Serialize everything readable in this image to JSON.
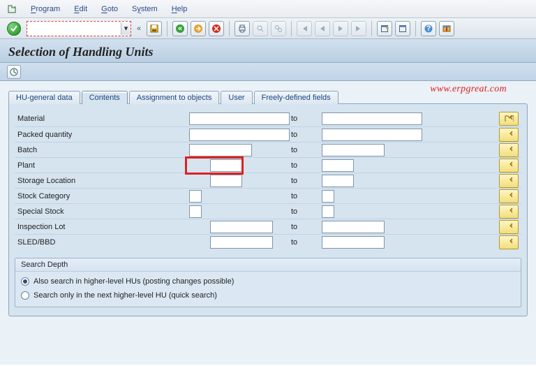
{
  "menu": {
    "items": [
      {
        "pre": "P",
        "rest": "rogram"
      },
      {
        "pre": "E",
        "rest": "dit"
      },
      {
        "pre": "G",
        "rest": "oto"
      },
      {
        "pre": "",
        "rest": "System",
        "nounder": true,
        "upos": 1
      },
      {
        "pre": "H",
        "rest": "elp"
      }
    ]
  },
  "toolbar": {
    "cmd_value": "",
    "back_chevrons": "«"
  },
  "page": {
    "title": "Selection of Handling Units"
  },
  "tabs": [
    {
      "label": "HU-general data",
      "active": false
    },
    {
      "label": "Contents",
      "active": true
    },
    {
      "label": "Assignment to objects",
      "active": false
    },
    {
      "label": "User",
      "active": false
    },
    {
      "label": "Freely-defined fields",
      "active": false
    }
  ],
  "watermark": "www.erpgreat.com",
  "fields": [
    {
      "label": "Material",
      "to": "to",
      "size": "l"
    },
    {
      "label": "Packed quantity",
      "to": "to",
      "size": "l"
    },
    {
      "label": "Batch",
      "to": "to",
      "size": "m"
    },
    {
      "label": "Plant",
      "to": "to",
      "size": "s",
      "highlight": true
    },
    {
      "label": "Storage Location",
      "to": "to",
      "size": "s"
    },
    {
      "label": "Stock Category",
      "to": "to",
      "size": "xs"
    },
    {
      "label": "Special Stock",
      "to": "to",
      "size": "xs"
    },
    {
      "label": "Inspection Lot",
      "to": "to",
      "size": "m"
    },
    {
      "label": "SLED/BBD",
      "to": "to",
      "size": "m"
    }
  ],
  "search_depth": {
    "legend": "Search Depth",
    "opt1": "Also search in higher-level HUs (posting changes possible)",
    "opt2": "Search only in the next higher-level HU (quick search)"
  }
}
